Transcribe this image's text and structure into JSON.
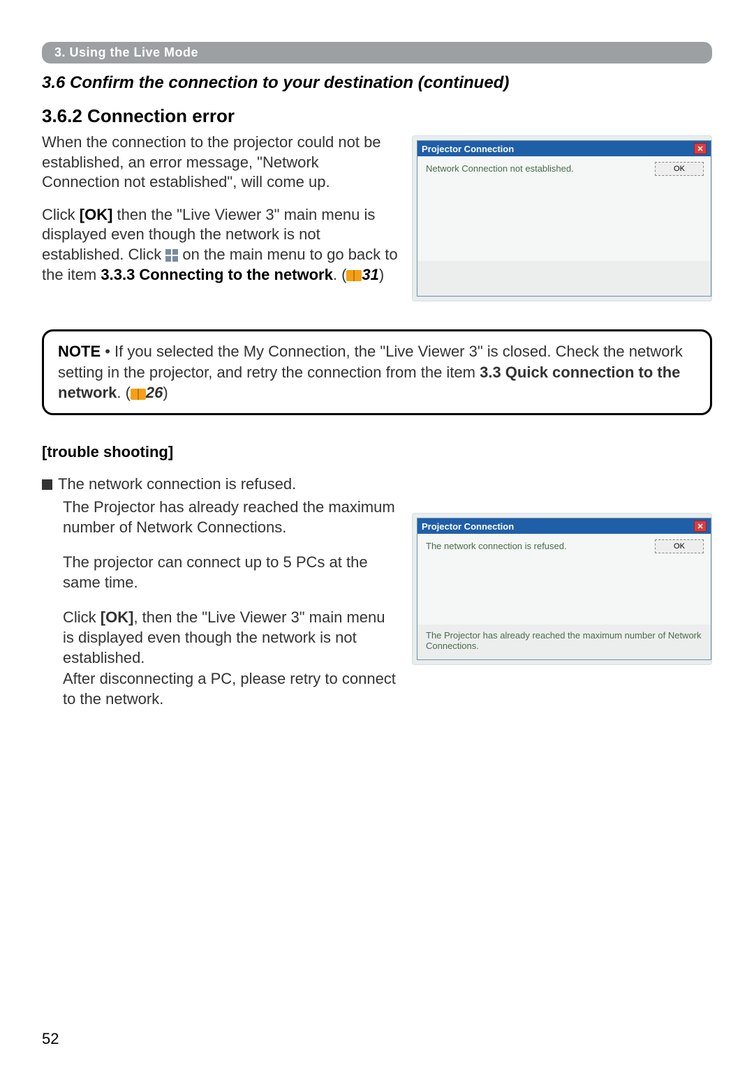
{
  "pill": "3. Using the Live Mode",
  "subtitle": "3.6 Confirm the connection to your destination (continued)",
  "h362": "3.6.2 Connection error",
  "p1": "When the connection to the projector could not be established, an error message, \"Network Connection not established\", will come up.",
  "p2_pre": "Click ",
  "p2_ok": "[OK]",
  "p2_mid": " then the \"Live Viewer 3\" main menu is displayed even though the network is not established. Click ",
  "p2_post": " on the main menu to go back to the item ",
  "p2_bold2": "3.3.3 Connecting to the network",
  "p2_end": ". (",
  "p2_ref": "31",
  "p2_close": ")",
  "dialog1": {
    "title": "Projector Connection",
    "msg": "Network Connection not established.",
    "ok": "OK"
  },
  "note": {
    "label": "NOTE",
    "body": " • If you selected the My Connection, the \"Live Viewer 3\" is closed. Check the network setting in the projector, and retry the connection from the item ",
    "bold": "3.3 Quick connection to the network",
    "end": ". (",
    "ref": "26",
    "close": ")"
  },
  "ts": "[trouble shooting]",
  "bullet": "The network connection is refused.",
  "ts_p1": "The Projector has already reached the maximum number of Network Connections.",
  "ts_p2": "The projector can connect up to 5 PCs at the same time.",
  "ts_p3_pre": "Click ",
  "ts_p3_ok": "[OK]",
  "ts_p3_post": ", then the \"Live Viewer 3\" main menu is displayed even though the network is not established.",
  "ts_p4": "After disconnecting a PC, please retry to connect to the network.",
  "dialog2": {
    "title": "Projector Connection",
    "msg": "The network connection is refused.",
    "ok": "OK",
    "footer": "The Projector has already reached the maximum number of Network Connections."
  },
  "pageNum": "52"
}
